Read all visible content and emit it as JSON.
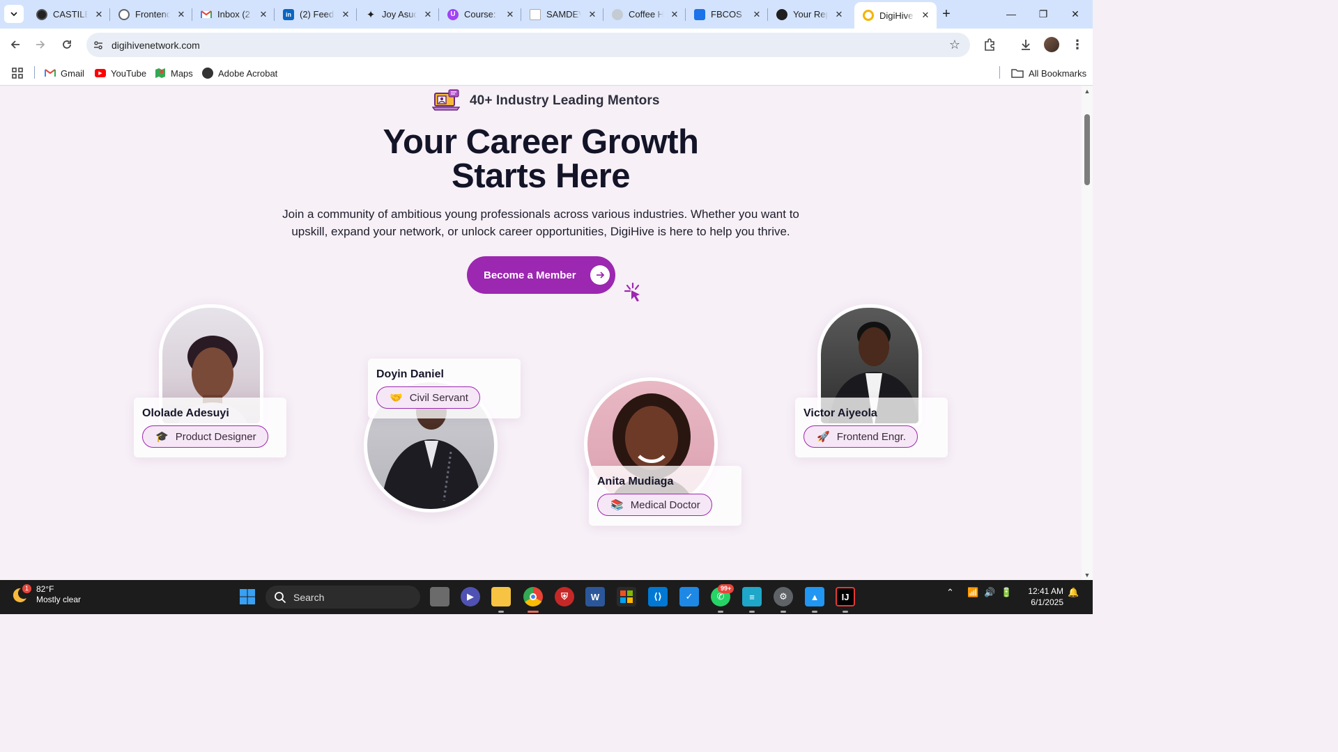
{
  "browser": {
    "tabs": [
      {
        "title": "CASTILE",
        "icon": "castile-favicon",
        "color": "#222222"
      },
      {
        "title": "Frontend",
        "icon": "globe-favicon",
        "color": "#5f6368"
      },
      {
        "title": "Inbox (2",
        "icon": "gmail-favicon",
        "color": "#ea4335"
      },
      {
        "title": "(2) Feed",
        "icon": "linkedin-favicon",
        "color": "#0a66c2"
      },
      {
        "title": "Joy Asuq",
        "icon": "gemini-favicon",
        "color": "#1f1f1f"
      },
      {
        "title": "Course:",
        "icon": "course-favicon",
        "color": "#a142f4"
      },
      {
        "title": "SAMDEV",
        "icon": "doc-favicon",
        "color": "#888888"
      },
      {
        "title": "Coffee H",
        "icon": "coffee-favicon",
        "color": "#9aa0a6"
      },
      {
        "title": "FBCOS",
        "icon": "chat-favicon",
        "color": "#1a73e8"
      },
      {
        "title": "Your Rep",
        "icon": "github-favicon",
        "color": "#1f1f1f"
      },
      {
        "title": "DigiHive",
        "icon": "digihive-favicon",
        "color": "#f4b400",
        "active": true
      }
    ],
    "url": "digihivenetwork.com",
    "bookmarks": [
      "Gmail",
      "YouTube",
      "Maps",
      "Adobe Acrobat"
    ],
    "all_bookmarks": "All Bookmarks"
  },
  "page": {
    "mentor_count": "40+ Industry Leading Mentors",
    "title_line1": "Your Career Growth",
    "title_line2": "Starts Here",
    "subtitle_line1": "Join a community of ambitious young professionals across various industries. Whether you want to",
    "subtitle_line2": "upskill, expand your network, or unlock career opportunities, DigiHive is here to help you thrive.",
    "cta_label": "Become a Member",
    "accent_color": "#9c27b0",
    "mentors": [
      {
        "name": "Ololade Adesuyi",
        "role": "Product Designer",
        "emoji": "🎓"
      },
      {
        "name": "Doyin Daniel",
        "role": "Civil Servant",
        "emoji": "🤝"
      },
      {
        "name": "Anita Mudiaga",
        "role": "Medical Doctor",
        "emoji": "📚"
      },
      {
        "name": "Victor Aiyeola",
        "role": "Frontend Engr.",
        "emoji": "🚀"
      }
    ]
  },
  "taskbar": {
    "weather_temp": "82°F",
    "weather_desc": "Mostly clear",
    "weather_badge": "1",
    "search_label": "Search",
    "whatsapp_badge": "99+",
    "time": "12:41 AM",
    "date": "6/1/2025"
  }
}
